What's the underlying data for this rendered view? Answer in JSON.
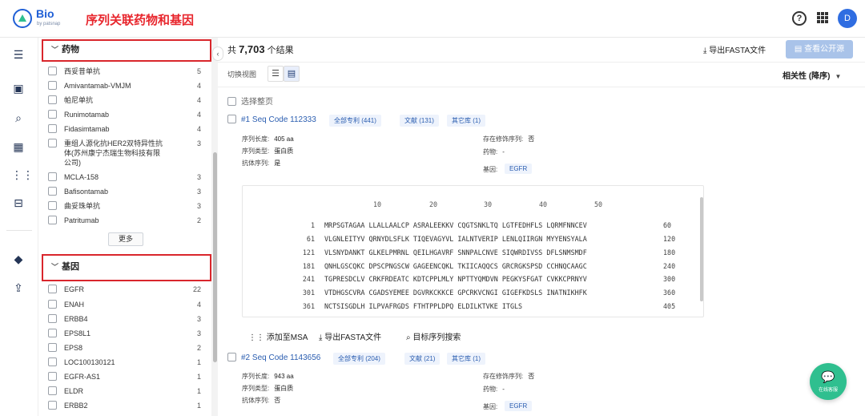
{
  "header": {
    "logo_text": "Bio",
    "logo_sub": "by patsnap",
    "page_heading": "序列关联药物和基因",
    "avatar_letter": "D"
  },
  "filters": {
    "drug_group": {
      "title": "药物",
      "items": [
        {
          "label": "西妥昔单抗",
          "count": "5"
        },
        {
          "label": "Amivantamab-VMJM",
          "count": "4"
        },
        {
          "label": "帕尼单抗",
          "count": "4"
        },
        {
          "label": "Runimotamab",
          "count": "4"
        },
        {
          "label": "Fidasimtamab",
          "count": "4"
        },
        {
          "label": "重组人源化抗HER2双特异性抗体(苏州康宁杰瑞生物科技有限公司)",
          "count": "3"
        },
        {
          "label": "MCLA-158",
          "count": "3"
        },
        {
          "label": "Bafisontamab",
          "count": "3"
        },
        {
          "label": "曲妥珠单抗",
          "count": "3"
        },
        {
          "label": "Patritumab",
          "count": "2"
        }
      ],
      "more_label": "更多"
    },
    "gene_group": {
      "title": "基因",
      "items": [
        {
          "label": "EGFR",
          "count": "22"
        },
        {
          "label": "ENAH",
          "count": "4"
        },
        {
          "label": "ERBB4",
          "count": "3"
        },
        {
          "label": "EPS8L1",
          "count": "3"
        },
        {
          "label": "EPS8",
          "count": "2"
        },
        {
          "label": "LOC100130121",
          "count": "1"
        },
        {
          "label": "EGFR-AS1",
          "count": "1"
        },
        {
          "label": "ELDR",
          "count": "1"
        },
        {
          "label": "ERBB2",
          "count": "1"
        }
      ]
    }
  },
  "toolbar": {
    "result_prefix": "共",
    "result_count": "7,703",
    "result_suffix": "个结果",
    "export_label": "导出FASTA文件",
    "public_label": "查看公开源",
    "view_label": "切换视图",
    "sort_label": "相关性 (降序)",
    "select_all_label": "选择整页"
  },
  "records": [
    {
      "title": "#1 Seq Code 112333",
      "tags": [
        "全部专利 (441)",
        "文献 (131)",
        "其它库 (1)"
      ],
      "length_label": "序列长度:",
      "length_value": "405 aa",
      "type_label": "序列类型:",
      "type_value": "蛋白质",
      "antibody_label": "抗体序列:",
      "antibody_value": "是",
      "modified_label": "存在修饰序列:",
      "modified_value": "否",
      "drug_label": "药物:",
      "drug_value": "-",
      "gene_label": "基因:",
      "gene_value": "EGFR"
    },
    {
      "title": "#2 Seq Code 1143656",
      "tags": [
        "全部专利 (204)",
        "文献 (21)",
        "其它库 (1)"
      ],
      "length_label": "序列长度:",
      "length_value": "943 aa",
      "type_label": "序列类型:",
      "type_value": "蛋白质",
      "antibody_label": "抗体序列:",
      "antibody_value": "否",
      "modified_label": "存在修饰序列:",
      "modified_value": "否",
      "drug_label": "药物:",
      "drug_value": "-",
      "gene_label": "基因:",
      "gene_value": "EGFR"
    }
  ],
  "sequence": {
    "ruler": [
      "10",
      "20",
      "30",
      "40",
      "50"
    ],
    "lines": [
      {
        "start": "1",
        "seq": "MRPSGTAGAA LLALLAALCP ASRALEEKKV CQGTSNKLTQ LGTFEDHFLS LQRMFNNCEV",
        "end": "60"
      },
      {
        "start": "61",
        "seq": "VLGNLEITYV QRNYDLSFLK TIQEVAGYVL IALNTVERIP LENLQIIRGN MYYENSYALA",
        "end": "120"
      },
      {
        "start": "121",
        "seq": "VLSNYDANKT GLKELPMRNL QEILHGAVRF SNNPALCNVE SIQWRDIVSS DFLSNMSMDF",
        "end": "180"
      },
      {
        "start": "181",
        "seq": "QNHLGSCQKC DPSCPNGSCW GAGEENCQKL TKIICAQQCS GRCRGKSPSD CCHNQCAAGC",
        "end": "240"
      },
      {
        "start": "241",
        "seq": "TGPRESDCLV CRKFRDEATC KDTCPPLMLY NPTTYQMDVN PEGKYSFGAT CVKKCPRNYV",
        "end": "300"
      },
      {
        "start": "301",
        "seq": "VTDHGSCVRA CGADSYEMEE DGVRKCKKCE GPCRKVCNGI GIGEFKDSLS INATNIKHFK",
        "end": "360"
      },
      {
        "start": "361",
        "seq": "NCTSISGDLH ILPVAFRGDS FTHTPPLDPQ ELDILKTVKE ITGLS",
        "end": "405"
      }
    ]
  },
  "actions": {
    "msa_label": "添加至MSA",
    "fasta_label": "导出FASTA文件",
    "target_search_label": "目标序列搜索"
  },
  "chat": {
    "label": "在线客服"
  }
}
